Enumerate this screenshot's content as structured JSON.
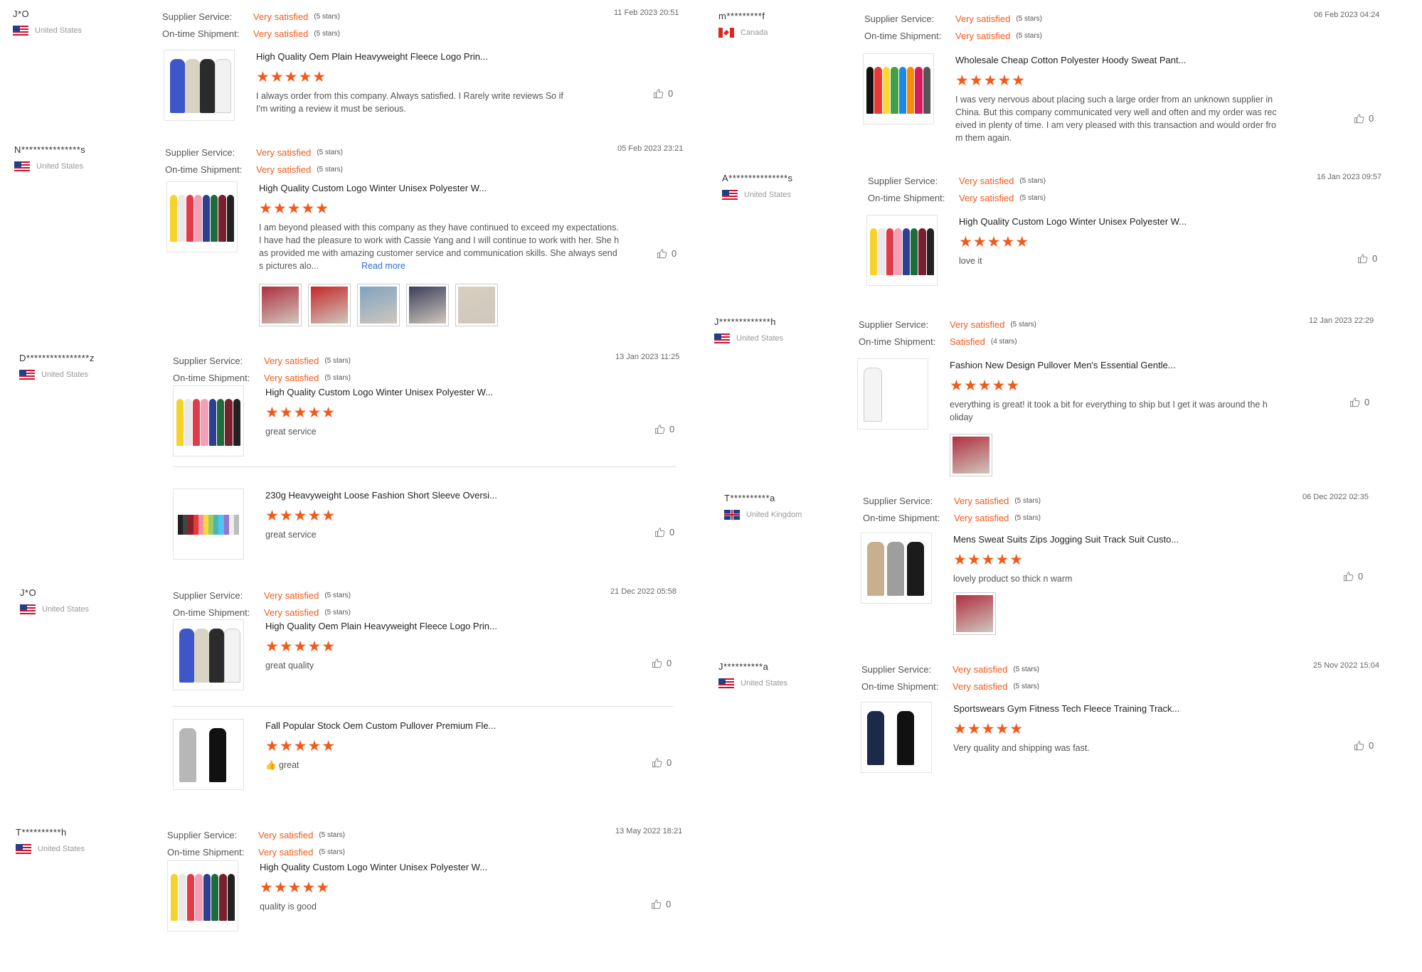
{
  "labels": {
    "supplier_service": "Supplier Service:",
    "ontime_shipment": "On-time Shipment:",
    "read_more": "Read more"
  },
  "colors": {
    "accent": "#f05a1a",
    "link": "#2a6fd6",
    "star": "#f05a1a"
  },
  "reviews": [
    {
      "buyer": "J*O",
      "country": "United States",
      "flag": "us-flag-icon",
      "supplier_value": "Very satisfied",
      "supplier_stars": "(5 stars)",
      "shipment_value": "Very satisfied",
      "shipment_stars": "(5 stars)",
      "date": "11 Feb 2023 20:51",
      "products": [
        {
          "title": "High Quality Oem Plain Heavyweight Fleece Logo Prin...",
          "rating": 5,
          "stars": "★★★★★",
          "text_lines": [
            "I always order from this company.  Always satisfied.  I Rarely write reviews So if",
            "I'm writing a review it must be serious."
          ],
          "likes": "0",
          "image": "tracksuit-image"
        }
      ]
    },
    {
      "buyer": "N***************s",
      "country": "United States",
      "flag": "us-flag-icon",
      "supplier_value": "Very satisfied",
      "supplier_stars": "(5 stars)",
      "shipment_value": "Very satisfied",
      "shipment_stars": "(5 stars)",
      "date": "05 Feb 2023 23:21",
      "products": [
        {
          "title": "High Quality Custom Logo Winter Unisex Polyester W...",
          "rating": 5,
          "stars": "★★★★★",
          "text_lines": [
            "I am beyond pleased with this company as they have continued to exceed my expectations.",
            "I have had the pleasure to work with Cassie Yang and I will continue to work with her. She h",
            "as provided me with amazing customer service and communication skills. She always send",
            "s pictures alo..."
          ],
          "likes": "0",
          "image": "hoodies-image"
        }
      ],
      "photos": 5
    },
    {
      "buyer": "D****************z",
      "country": "United States",
      "flag": "us-flag-icon",
      "supplier_value": "Very satisfied",
      "supplier_stars": "(5 stars)",
      "shipment_value": "Very satisfied",
      "shipment_stars": "(5 stars)",
      "date": "13 Jan 2023 11:25",
      "products": [
        {
          "title": "High Quality Custom Logo Winter Unisex Polyester W...",
          "rating": 5,
          "stars": "★★★★★",
          "text_lines": [
            "great service"
          ],
          "likes": "0",
          "image": "hoodies-image"
        },
        {
          "title": "230g Heavyweight Loose Fashion Short Sleeve Oversi...",
          "rating": 5,
          "stars": "★★★★★",
          "text_lines": [
            "great service"
          ],
          "likes": "0",
          "image": "tshirts-image"
        }
      ]
    },
    {
      "buyer": "J*O",
      "country": "United States",
      "flag": "us-flag-icon",
      "supplier_value": "Very satisfied",
      "supplier_stars": "(5 stars)",
      "shipment_value": "Very satisfied",
      "shipment_stars": "(5 stars)",
      "date": "21 Dec 2022 05:58",
      "products": [
        {
          "title": "High Quality Oem Plain Heavyweight Fleece Logo Prin...",
          "rating": 5,
          "stars": "★★★★★",
          "text_lines": [
            "great quality"
          ],
          "likes": "0",
          "image": "tracksuit-image"
        },
        {
          "title": "Fall Popular Stock Oem Custom Pullover Premium Fle...",
          "rating": 5,
          "stars": "★★★★★",
          "text_lines": [
            "👍 great"
          ],
          "likes": "0",
          "image": "zip-hoodie-image"
        }
      ]
    },
    {
      "buyer": "T**********h",
      "country": "United States",
      "flag": "us-flag-icon",
      "supplier_value": "Very satisfied",
      "supplier_stars": "(5 stars)",
      "shipment_value": "Very satisfied",
      "shipment_stars": "(5 stars)",
      "date": "13 May 2022 18:21",
      "products": [
        {
          "title": "High Quality Custom Logo Winter Unisex Polyester W...",
          "rating": 5,
          "stars": "★★★★★",
          "text_lines": [
            "quality is good"
          ],
          "likes": "0",
          "image": "hoodies-image"
        }
      ]
    },
    {
      "buyer": "m*********f",
      "country": "Canada",
      "flag": "canada-flag-icon",
      "supplier_value": "Very satisfied",
      "supplier_stars": "(5 stars)",
      "shipment_value": "Very satisfied",
      "shipment_stars": "(5 stars)",
      "date": "06 Feb 2023 04:24",
      "products": [
        {
          "title": "Wholesale Cheap Cotton Polyester Hoody Sweat Pant...",
          "rating": 5,
          "stars": "★★★★★",
          "text_lines": [
            "I was very nervous about placing such a large order from an unknown supplier in",
            "China. But this company communicated very well and often and my order was rec",
            "eived in plenty of time. I am very pleased with this transaction and would order fro",
            "m them again."
          ],
          "likes": "0",
          "image": "color-hoodies-image"
        }
      ]
    },
    {
      "buyer": "A***************s",
      "country": "United States",
      "flag": "us-flag-icon",
      "supplier_value": "Very satisfied",
      "supplier_stars": "(5 stars)",
      "shipment_value": "Very satisfied",
      "shipment_stars": "(5 stars)",
      "date": "16 Jan 2023 09:57",
      "products": [
        {
          "title": "High Quality Custom Logo Winter Unisex Polyester W...",
          "rating": 5,
          "stars": "★★★★★",
          "text_lines": [
            "love it"
          ],
          "likes": "0",
          "image": "hoodies-image"
        }
      ]
    },
    {
      "buyer": "J*************h",
      "country": "United States",
      "flag": "us-flag-icon",
      "supplier_value": "Very satisfied",
      "supplier_stars": "(5 stars)",
      "shipment_value": "Satisfied",
      "shipment_stars": "(4 stars)",
      "date": "12 Jan 2023 22:29",
      "products": [
        {
          "title": "Fashion New Design Pullover Men's Essential Gentle...",
          "rating": 5,
          "stars": "★★★★★",
          "text_lines": [
            "everything is great! it took a bit for everything to ship but I get it was around the h",
            "oliday"
          ],
          "likes": "0",
          "image": "white-hoodie-image"
        }
      ],
      "photos": 1
    },
    {
      "buyer": "T**********a",
      "country": "United Kingdom",
      "flag": "uk-flag-icon",
      "supplier_value": "Very satisfied",
      "supplier_stars": "(5 stars)",
      "shipment_value": "Very satisfied",
      "shipment_stars": "(5 stars)",
      "date": "06 Dec 2022 02:35",
      "products": [
        {
          "title": "Mens Sweat Suits Zips Jogging Suit Track Suit Custo...",
          "rating": 5,
          "stars": "★★★★★",
          "text_lines": [
            "lovely product so thick n warm"
          ],
          "likes": "0",
          "image": "sweat-suits-image"
        }
      ],
      "photos": 1
    },
    {
      "buyer": "J**********a",
      "country": "United States",
      "flag": "us-flag-icon",
      "supplier_value": "Very satisfied",
      "supplier_stars": "(5 stars)",
      "shipment_value": "Very satisfied",
      "shipment_stars": "(5 stars)",
      "date": "25 Nov 2022 15:04",
      "products": [
        {
          "title": "Sportswears Gym Fitness Tech Fleece Training Track...",
          "rating": 5,
          "stars": "★★★★★",
          "text_lines": [
            "Very quality and shipping was fast."
          ],
          "likes": "0",
          "image": "tech-fleece-image"
        }
      ]
    }
  ]
}
